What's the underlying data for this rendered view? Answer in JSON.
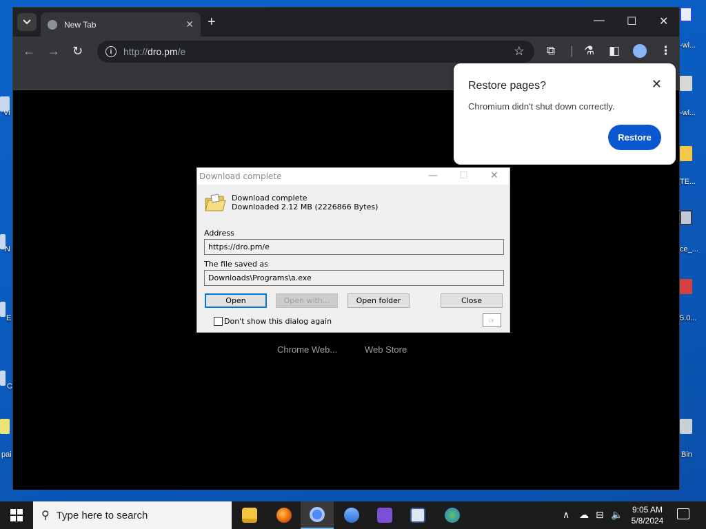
{
  "desktop": {
    "left_icon_labels": [
      "Vi",
      "N",
      "E",
      "C",
      "pai"
    ],
    "right_icon_labels": [
      "-wl...",
      "-wl...",
      "TE...",
      "ce_...",
      "5.0...",
      "Bin"
    ]
  },
  "browser": {
    "tab": {
      "title": "New Tab",
      "close_icon": "close-icon"
    },
    "new_tab_symbol": "+",
    "window_controls": {
      "minimize": "—",
      "maximize": "☐",
      "close": "✕"
    },
    "omnibox": {
      "scheme": "http://",
      "host": "dro.pm",
      "path": "/e"
    },
    "ntp_shortcuts": [
      "Chrome Web...",
      "Web Store"
    ]
  },
  "restore_bubble": {
    "title": "Restore pages?",
    "body": "Chromium didn't shut down correctly.",
    "button": "Restore",
    "accent": "#0b57d0"
  },
  "download_dialog": {
    "title": "Download complete",
    "heading": "Download complete",
    "subheading": "Downloaded 2.12  MB (2226866 Bytes)",
    "address_label": "Address",
    "address_value": "https://dro.pm/e",
    "saved_label": "The file saved as",
    "saved_value": "Downloads\\Programs\\a.exe",
    "buttons": {
      "open": "Open",
      "open_with": "Open with...",
      "open_folder": "Open folder",
      "close": "Close"
    },
    "checkbox_label": "Don't show this dialog again",
    "checkbox_checked": false
  },
  "taskbar": {
    "search_placeholder": "Type here to search",
    "clock_time": "9:05 AM",
    "clock_date": "5/8/2024",
    "apps": [
      "file-explorer",
      "firefox",
      "chromium",
      "people-app",
      "visual-studio",
      "paint-app",
      "network-app"
    ],
    "active_app": "chromium"
  }
}
